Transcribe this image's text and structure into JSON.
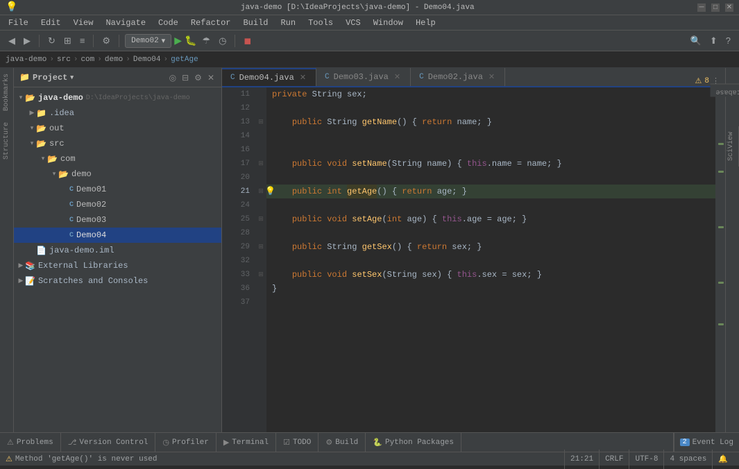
{
  "titleBar": {
    "title": "java-demo [D:\\IdeaProjects\\java-demo] - Demo04.java",
    "menuItems": [
      "java-demo",
      "File",
      "Edit",
      "View",
      "Navigate",
      "Code",
      "Refactor",
      "Build",
      "Run",
      "Tools",
      "VCS",
      "Window",
      "Help"
    ]
  },
  "breadcrumb": {
    "items": [
      "java-demo",
      "src",
      "com",
      "demo",
      "Demo04",
      "getAge"
    ]
  },
  "tabs": [
    {
      "label": "Demo04.java",
      "active": true
    },
    {
      "label": "Demo03.java",
      "active": false
    },
    {
      "label": "Demo02.java",
      "active": false
    }
  ],
  "runConfig": "Demo02",
  "alertCount": "8",
  "fileTree": {
    "rootLabel": "java-demo",
    "rootPath": "D:\\IdeaProjects\\java-demo",
    "items": [
      {
        "indent": 0,
        "type": "project-root",
        "label": "java-demo",
        "path": "D:\\IdeaProjects\\java-demo"
      },
      {
        "indent": 1,
        "type": "folder",
        "label": ".idea"
      },
      {
        "indent": 1,
        "type": "folder",
        "label": "out",
        "expanded": true
      },
      {
        "indent": 1,
        "type": "folder",
        "label": "src",
        "expanded": true
      },
      {
        "indent": 2,
        "type": "folder",
        "label": "com",
        "expanded": true
      },
      {
        "indent": 3,
        "type": "folder",
        "label": "demo",
        "expanded": true
      },
      {
        "indent": 4,
        "type": "java",
        "label": "Demo01"
      },
      {
        "indent": 4,
        "type": "java",
        "label": "Demo02"
      },
      {
        "indent": 4,
        "type": "java",
        "label": "Demo03"
      },
      {
        "indent": 4,
        "type": "java",
        "label": "Demo04",
        "selected": true
      },
      {
        "indent": 1,
        "type": "iml",
        "label": "java-demo.iml"
      },
      {
        "indent": 0,
        "type": "ext-lib",
        "label": "External Libraries"
      },
      {
        "indent": 0,
        "type": "scratches",
        "label": "Scratches and Consoles"
      }
    ]
  },
  "codeLines": [
    {
      "num": 11,
      "tokens": [
        {
          "t": "    ",
          "c": ""
        },
        {
          "t": "private",
          "c": "kw"
        },
        {
          "t": " String sex;",
          "c": ""
        }
      ]
    },
    {
      "num": 12,
      "tokens": []
    },
    {
      "num": 13,
      "tokens": [
        {
          "t": "    ",
          "c": ""
        },
        {
          "t": "public",
          "c": "kw"
        },
        {
          "t": " String ",
          "c": ""
        },
        {
          "t": "getName",
          "c": "method"
        },
        {
          "t": "() { ",
          "c": ""
        },
        {
          "t": "return",
          "c": "kw"
        },
        {
          "t": " name; }",
          "c": ""
        }
      ]
    },
    {
      "num": 14,
      "tokens": []
    },
    {
      "num": 16,
      "tokens": []
    },
    {
      "num": 17,
      "tokens": [
        {
          "t": "    ",
          "c": ""
        },
        {
          "t": "public",
          "c": "kw"
        },
        {
          "t": " ",
          "c": ""
        },
        {
          "t": "void",
          "c": "kw"
        },
        {
          "t": " ",
          "c": ""
        },
        {
          "t": "setName",
          "c": "method"
        },
        {
          "t": "(String name) { ",
          "c": ""
        },
        {
          "t": "this",
          "c": "this-kw"
        },
        {
          "t": ".name = name; }",
          "c": ""
        }
      ]
    },
    {
      "num": 20,
      "tokens": []
    },
    {
      "num": 21,
      "tokens": [
        {
          "t": "    ",
          "c": ""
        },
        {
          "t": "public",
          "c": "kw"
        },
        {
          "t": " ",
          "c": ""
        },
        {
          "t": "int",
          "c": "kw"
        },
        {
          "t": " ",
          "c": ""
        },
        {
          "t": "getAge",
          "c": "method-highlight"
        },
        {
          "t": "() { ",
          "c": ""
        },
        {
          "t": "return",
          "c": "kw"
        },
        {
          "t": " age; }",
          "c": ""
        }
      ],
      "highlight": true,
      "hasBulb": true
    },
    {
      "num": 24,
      "tokens": []
    },
    {
      "num": 25,
      "tokens": [
        {
          "t": "    ",
          "c": ""
        },
        {
          "t": "public",
          "c": "kw"
        },
        {
          "t": " ",
          "c": ""
        },
        {
          "t": "void",
          "c": "kw"
        },
        {
          "t": " ",
          "c": ""
        },
        {
          "t": "setAge",
          "c": "method"
        },
        {
          "t": "(",
          "c": ""
        },
        {
          "t": "int",
          "c": "kw"
        },
        {
          "t": " age) { ",
          "c": ""
        },
        {
          "t": "this",
          "c": "this-kw"
        },
        {
          "t": ".age = age; }",
          "c": ""
        }
      ]
    },
    {
      "num": 28,
      "tokens": []
    },
    {
      "num": 29,
      "tokens": [
        {
          "t": "    ",
          "c": ""
        },
        {
          "t": "public",
          "c": "kw"
        },
        {
          "t": " String ",
          "c": ""
        },
        {
          "t": "getSex",
          "c": "method"
        },
        {
          "t": "() { ",
          "c": ""
        },
        {
          "t": "return",
          "c": "kw"
        },
        {
          "t": " sex; }",
          "c": ""
        }
      ]
    },
    {
      "num": 32,
      "tokens": []
    },
    {
      "num": 33,
      "tokens": [
        {
          "t": "    ",
          "c": ""
        },
        {
          "t": "public",
          "c": "kw"
        },
        {
          "t": " ",
          "c": ""
        },
        {
          "t": "void",
          "c": "kw"
        },
        {
          "t": " ",
          "c": ""
        },
        {
          "t": "setSex",
          "c": "method"
        },
        {
          "t": "(String sex) { ",
          "c": ""
        },
        {
          "t": "this",
          "c": "this-kw"
        },
        {
          "t": ".sex = sex; }",
          "c": ""
        }
      ]
    },
    {
      "num": 36,
      "tokens": [
        {
          "t": "}",
          "c": ""
        }
      ]
    },
    {
      "num": 37,
      "tokens": []
    }
  ],
  "bottomBar": {
    "buttons": [
      {
        "icon": "⚠",
        "label": "Problems",
        "id": "problems"
      },
      {
        "icon": "⎇",
        "label": "Version Control",
        "id": "vcs"
      },
      {
        "icon": "◷",
        "label": "Profiler",
        "id": "profiler"
      },
      {
        "icon": "▶",
        "label": "Terminal",
        "id": "terminal"
      },
      {
        "icon": "☑",
        "label": "TODO",
        "id": "todo"
      },
      {
        "icon": "⚙",
        "label": "Build",
        "id": "build"
      },
      {
        "icon": "🐍",
        "label": "Python Packages",
        "id": "python"
      }
    ],
    "rightItems": [
      {
        "label": "Event Log",
        "id": "event-log",
        "badge": "2"
      }
    ]
  },
  "statusBar": {
    "message": "Method 'getAge()' is never used",
    "position": "21:21",
    "lineEnding": "CRLF",
    "encoding": "UTF-8",
    "indent": "4 spaces",
    "warningIcon": "⚠"
  },
  "rightSidebar": {
    "tabs": [
      "Database",
      "SciView"
    ]
  }
}
